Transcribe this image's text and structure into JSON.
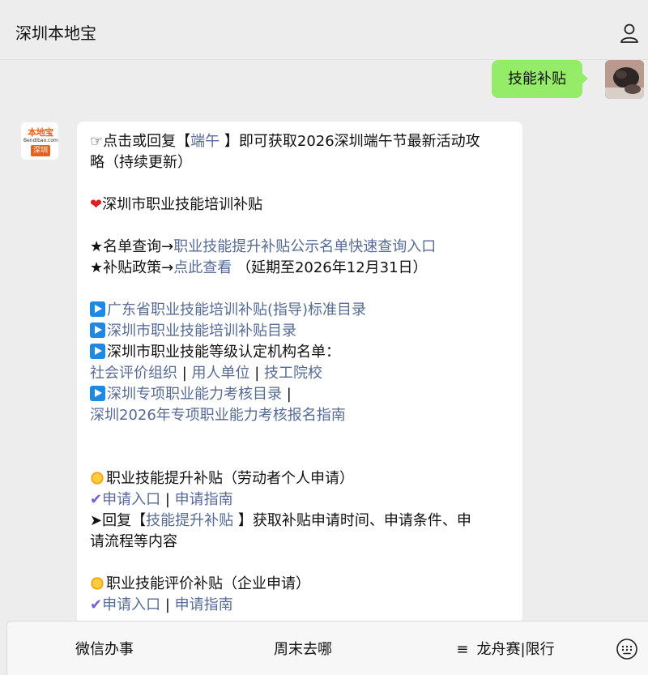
{
  "header": {
    "title": "深圳本地宝",
    "profile_icon": "person-icon"
  },
  "outgoing": {
    "text": "技能补贴"
  },
  "bot": {
    "avatar_top": "本地宝",
    "avatar_mid": "Bendibao.com",
    "avatar_bottom": "深圳"
  },
  "message": {
    "line1_prefix": "☞点击或回复【",
    "line1_link": "端午",
    "line1_suffix": " 】即可获取2026深圳端午节最新活动攻",
    "line2": "略（持续更新）",
    "section1_title": "深圳市职业技能培训补贴",
    "list_query_label": "★名单查询→",
    "list_query_link": "职业技能提升补贴公示名单快速查询入口",
    "policy_label": "★补贴政策→",
    "policy_link": "点此查看",
    "policy_note": " （延期至2026年12月31日）",
    "item1": "广东省职业技能培训补贴(指导)标准目录",
    "item2": "深圳市职业技能培训补贴目录",
    "item3": "深圳市职业技能等级认定机构名单：",
    "org1": "社会评价组织",
    "org2": "用人单位",
    "org3": "技工院校",
    "sep": " | ",
    "item4": "深圳专项职业能力考核目录",
    "item4_sep": " |",
    "item5": "深圳2026年专项职业能力考核报名指南",
    "section2_title": "职业技能提升补贴（劳动者个人申请）",
    "apply_entry": "申请入口",
    "apply_guide": "申请指南",
    "reply_prefix": "➤回复【",
    "reply_link": "技能提升补贴",
    "reply_suffix": " 】获取补贴申请时间、申请条件、申",
    "reply_line2": "请流程等内容",
    "section3_title": "职业技能评价补贴（企业申请）",
    "apply_entry2": "申请入口",
    "apply_guide2": "申请指南"
  },
  "menu": {
    "item1": "微信办事",
    "item2": "周末去哪",
    "item3": "龙舟赛|限行",
    "menu_icon": "hamburger-icon",
    "keyboard_icon": "keyboard-icon"
  },
  "colors": {
    "link": "#576b95",
    "outgoing_bubble": "#95ec69",
    "background": "#ededed"
  }
}
